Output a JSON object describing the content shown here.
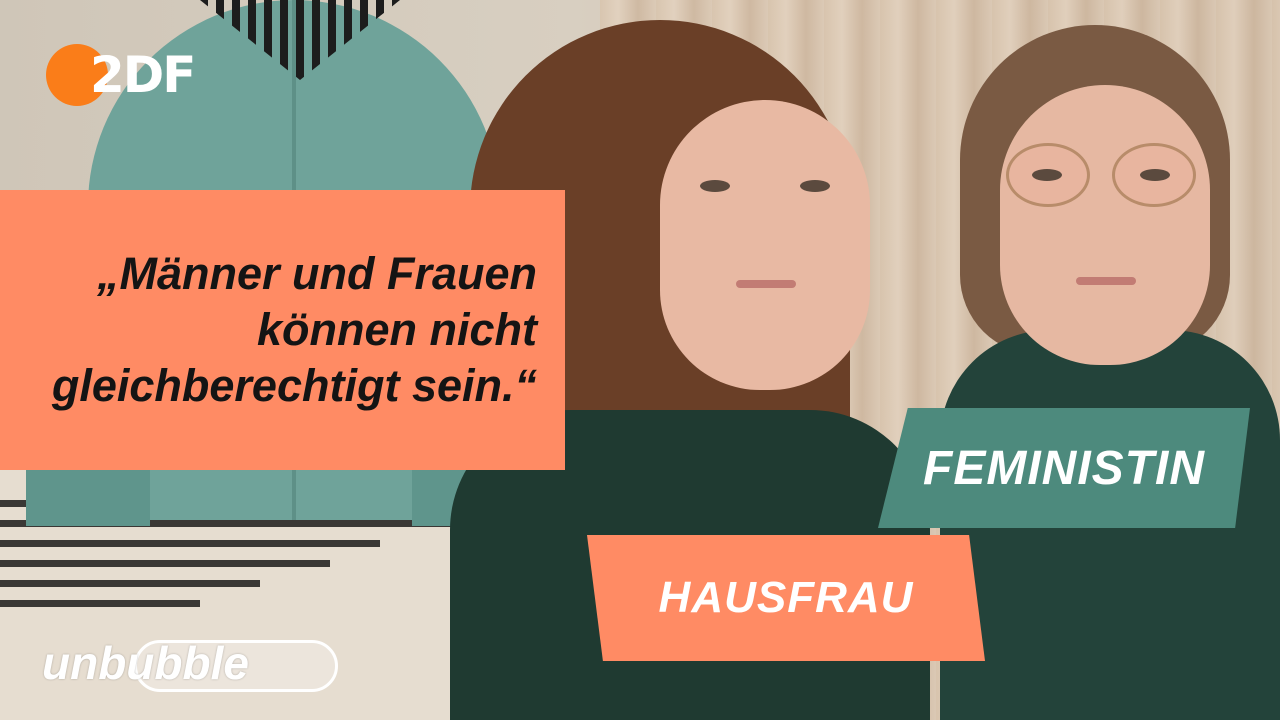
{
  "channel_logo": {
    "text": "2DF"
  },
  "quote": {
    "text": "„Männer und Frauen können nicht gleichberechtigt sein.“"
  },
  "labels": {
    "feminist": "FEMINISTIN",
    "housewife": "HAUSFRAU"
  },
  "show_logo": {
    "text": "unbubble"
  },
  "colors": {
    "orange": "#ff8b64",
    "teal": "#4d8a7d",
    "logo_orange": "#fa7d19"
  }
}
